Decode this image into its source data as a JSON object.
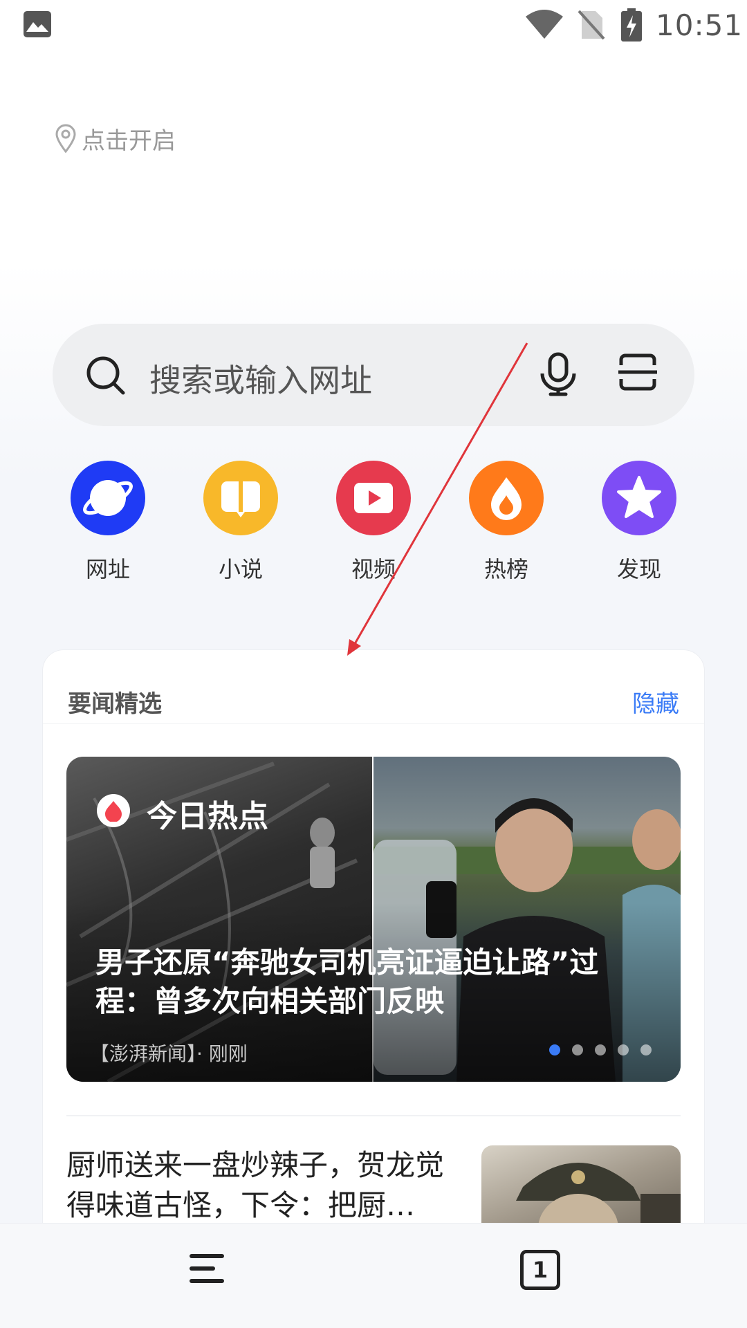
{
  "status_bar": {
    "time": "10:51",
    "icons": [
      "gallery-icon",
      "wifi-icon",
      "no-sim-icon",
      "battery-charging-icon"
    ]
  },
  "location": {
    "text": "点击开启",
    "icon": "location-pin-icon"
  },
  "search": {
    "placeholder": "搜索或输入网址",
    "icons": [
      "search-icon",
      "microphone-icon",
      "scan-icon"
    ]
  },
  "shortcuts": [
    {
      "label": "网址",
      "icon": "planet-icon",
      "color": "#1f3bf5"
    },
    {
      "label": "小说",
      "icon": "book-icon",
      "color": "#f8b82a"
    },
    {
      "label": "视频",
      "icon": "play-icon",
      "color": "#e63a4e"
    },
    {
      "label": "热榜",
      "icon": "flame-icon",
      "color": "#ff7a1a"
    },
    {
      "label": "发现",
      "icon": "star-icon",
      "color": "#7e4df5"
    }
  ],
  "news": {
    "section_title": "要闻精选",
    "hide_label": "隐藏",
    "banner": {
      "badge_label": "今日热点",
      "title": "男子还原“奔驰女司机亮证逼迫让路”过程：曾多次向相关部门反映",
      "source": "【澎湃新闻】· 刚刚",
      "page_count": 5,
      "active_page": 1
    },
    "items": [
      {
        "title": "厨师送来一盘炒辣子，贺龙觉得味道古怪，下令：把厨…"
      }
    ]
  },
  "bottom_nav": {
    "menu_icon": "menu-icon",
    "tab_count": "1"
  },
  "colors": {
    "accent": "#3a7bf6",
    "annotation_arrow": "#e0353b"
  }
}
